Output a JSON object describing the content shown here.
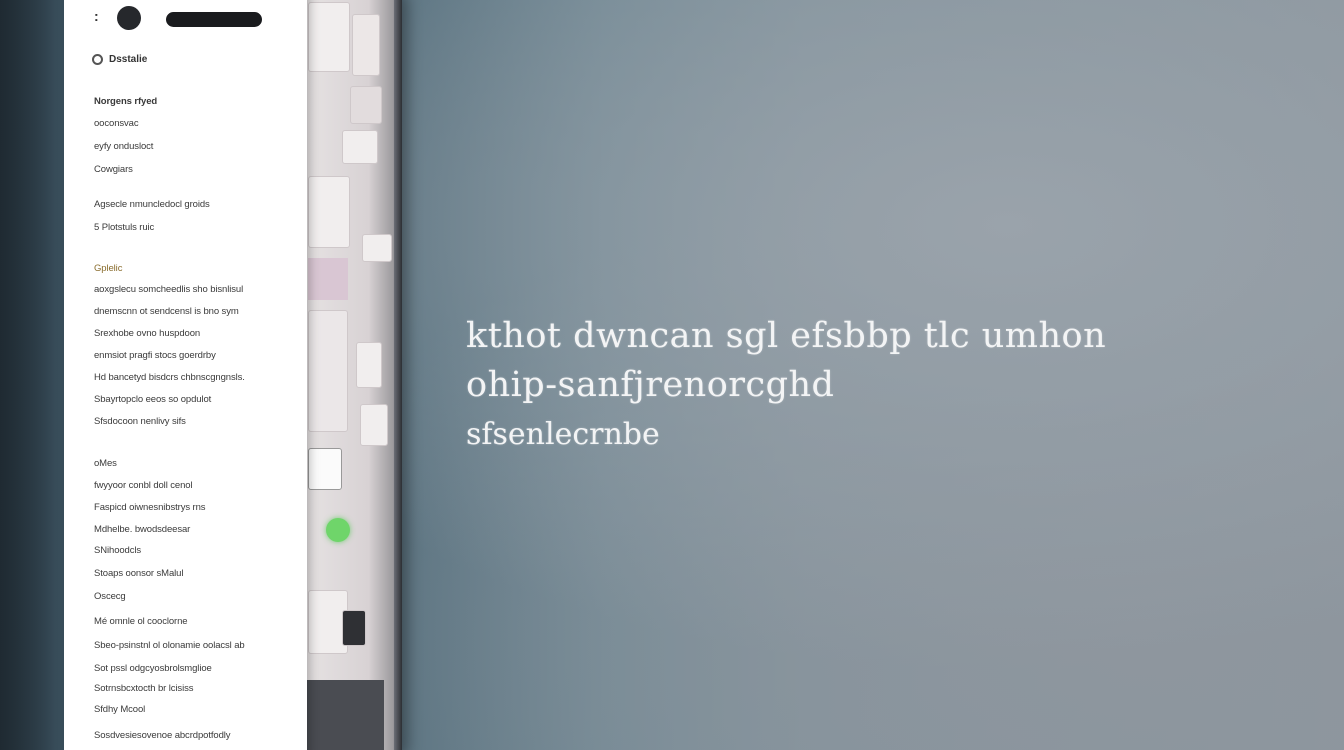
{
  "panel": {
    "header_label": "Dsstalie",
    "items": [
      "Norgens rfyed",
      "ooconsvac",
      "eyfy ondusloct",
      "Cowgiars",
      "Agsecle nmuncledocl groids",
      "5 Plotstuls ruic",
      "Gplelic",
      "aoxgslecu somcheedlis sho bisnlisul",
      "dnemscnn ot sendcensl is bno sym",
      "Srexhobe ovno huspdoon",
      "enmsiot pragfi stocs goerdrby",
      "Hd bancetyd bisdcrs chbnscgngnsls.",
      "Sbayrtopclo eeos so opdulot",
      "Sfsdocoon nenlivy sifs",
      "oMes",
      "fwyyoor conbl doll cenol",
      "Faspicd oiwnesnibstrys rns",
      "Mdhelbe. bwodsdeesar",
      "SNihoodcls",
      "Stoaps oonsor sMalul",
      "Oscecg",
      "Mé omnle ol cooclorne",
      "Sbeo-psinstnl ol olonamie oolacsl ab",
      "Sot pssl odgcyosbrolsmglioe",
      "Sotrnsbcxtocth br lcisiss",
      "Sfdhy Mcool",
      "Sosdvesiesovenoe abcrdpotfodly"
    ]
  },
  "headline": {
    "line1": "kthot dwncan sgl efsbbp tlc umhon",
    "line2": "ohip-sanfjrenorcghd",
    "line3": "sfsenlecrnbe"
  },
  "colors": {
    "background": "#7f919b",
    "panel": "#ffffff",
    "section_accent": "#8a6d2e",
    "green_indicator": "#6fd56a"
  }
}
